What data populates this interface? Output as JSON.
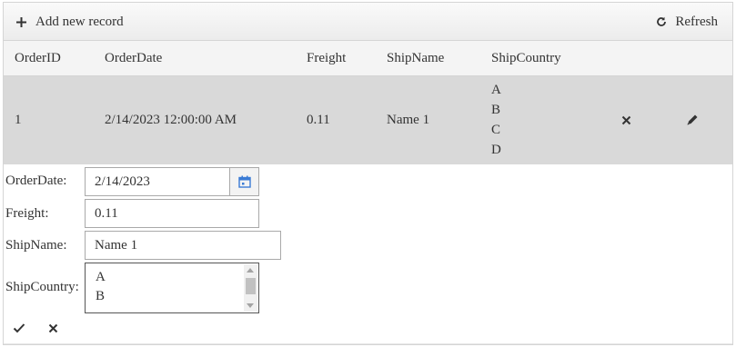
{
  "toolbar": {
    "add_label": "Add new record",
    "refresh_label": "Refresh"
  },
  "columns": [
    "OrderID",
    "OrderDate",
    "Freight",
    "ShipName",
    "ShipCountry"
  ],
  "row": {
    "order_id": "1",
    "order_date": "2/14/2023 12:00:00 AM",
    "freight": "0.11",
    "ship_name": "Name 1",
    "ship_country": [
      "A",
      "B",
      "C",
      "D"
    ]
  },
  "edit_form": {
    "labels": {
      "order_date": "OrderDate:",
      "freight": "Freight:",
      "ship_name": "ShipName:",
      "ship_country": "ShipCountry:"
    },
    "values": {
      "order_date": "2/14/2023",
      "freight": "0.11",
      "ship_name": "Name 1"
    },
    "country_options": [
      "A",
      "B"
    ]
  },
  "icons": {
    "add": "plus-icon",
    "refresh": "refresh-icon",
    "delete": "close-icon",
    "edit": "pencil-icon",
    "calendar": "calendar-icon",
    "update": "check-icon",
    "cancel": "close-icon"
  },
  "colors": {
    "selected_row": "#d9d9d9",
    "header_bg": "#f4f4f4",
    "calendar_accent": "#3a7bd5"
  }
}
